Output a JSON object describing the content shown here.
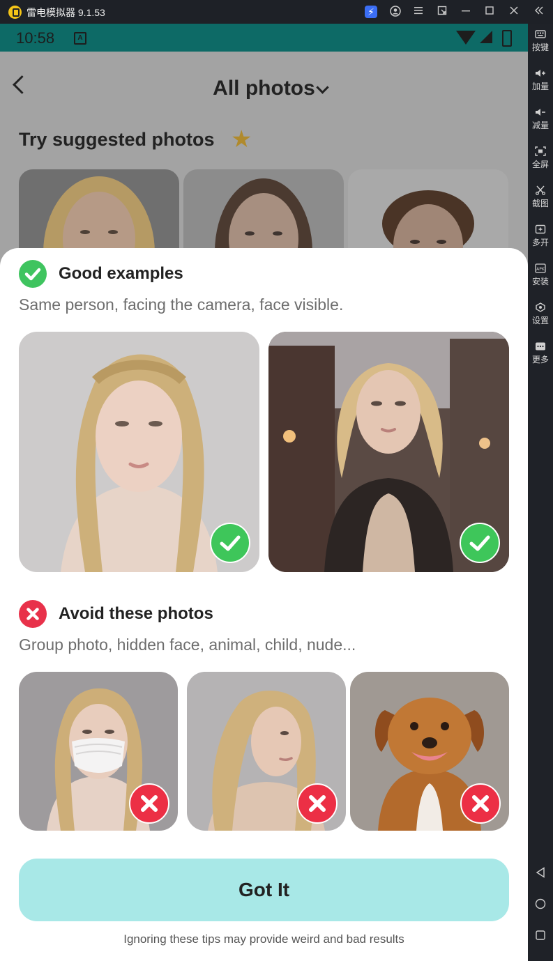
{
  "window": {
    "title": "雷电模拟器 9.1.53",
    "title_icons": [
      "bolt-icon",
      "user-icon",
      "menu-icon",
      "popout-icon",
      "minimize-icon",
      "maximize-icon",
      "close-icon"
    ],
    "collapse_icon": "double-chevron-left-icon"
  },
  "sidebar": {
    "items": [
      {
        "label": "按键",
        "icon": "keyboard-icon"
      },
      {
        "label": "加量",
        "icon": "volume-up-icon"
      },
      {
        "label": "减量",
        "icon": "volume-down-icon"
      },
      {
        "label": "全屏",
        "icon": "fullscreen-icon"
      },
      {
        "label": "截图",
        "icon": "scissors-icon"
      },
      {
        "label": "多开",
        "icon": "multi-instance-icon"
      },
      {
        "label": "安装",
        "icon": "apk-icon"
      },
      {
        "label": "设置",
        "icon": "settings-icon"
      },
      {
        "label": "更多",
        "icon": "more-icon"
      }
    ],
    "nav": [
      "back-triangle-icon",
      "home-circle-icon",
      "recents-square-icon"
    ]
  },
  "status_bar": {
    "time": "10:58",
    "notification_icon": "A"
  },
  "header": {
    "title": "All photos",
    "suggest_title": "Try suggested photos"
  },
  "sheet": {
    "good": {
      "title": "Good examples",
      "subtitle": "Same person, facing the camera, face visible."
    },
    "bad": {
      "title": "Avoid these photos",
      "subtitle": "Group photo, hidden face, animal, child, nude..."
    },
    "button_label": "Got It",
    "footer": "Ignoring these tips may provide weird and bad results"
  },
  "colors": {
    "status_bar": "#0d6a66",
    "good": "#3fc45f",
    "bad": "#e8314a",
    "button": "#a8e8e7"
  }
}
